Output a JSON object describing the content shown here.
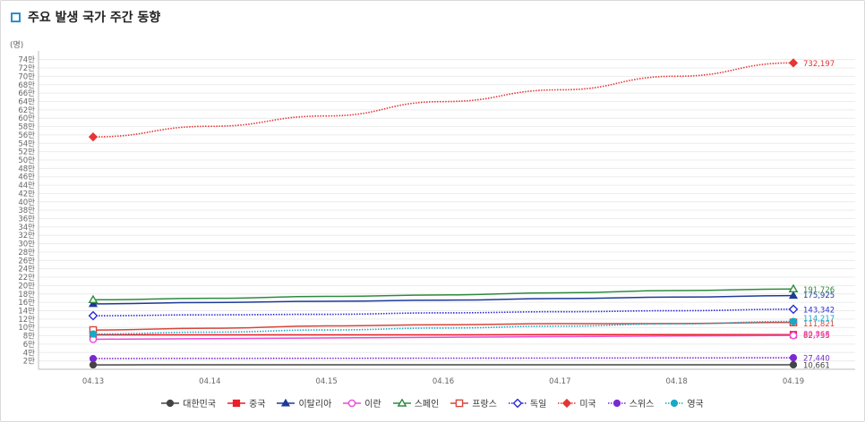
{
  "header": {
    "title": "주요 발생 국가 주간 동향",
    "unit_label": "(명)"
  },
  "chart_data": {
    "type": "line",
    "title": "주요 발생 국가 주간 동향",
    "xlabel": "",
    "ylabel": "(명)",
    "categories": [
      "04.13",
      "04.14",
      "04.15",
      "04.16",
      "04.17",
      "04.18",
      "04.19"
    ],
    "ylim": [
      0,
      750000
    ],
    "y_ticks": [
      "2만",
      "4만",
      "6만",
      "8만",
      "10만",
      "12만",
      "14만",
      "16만",
      "18만",
      "20만",
      "22만",
      "24만",
      "26만",
      "28만",
      "30만",
      "32만",
      "34만",
      "36만",
      "38만",
      "40만",
      "42만",
      "44만",
      "46만",
      "48만",
      "50만",
      "52만",
      "54만",
      "56만",
      "58만",
      "60만",
      "62만",
      "64만",
      "66만",
      "68만",
      "70만",
      "72만",
      "74만"
    ],
    "grid": true,
    "legend_position": "bottom",
    "series": [
      {
        "name": "대한민국",
        "color": "#444444",
        "marker": "circle-filled",
        "dash": "solid",
        "values": [
          10537,
          10564,
          10591,
          10613,
          10635,
          10653,
          10661
        ],
        "end_label": "10,661"
      },
      {
        "name": "중국",
        "color": "#e8202a",
        "marker": "square-filled",
        "dash": "solid",
        "values": [
          82160,
          82249,
          82295,
          82341,
          82692,
          82719,
          82735
        ],
        "end_label": "82,735"
      },
      {
        "name": "이탈리아",
        "color": "#1e3a9a",
        "marker": "triangle-filled",
        "dash": "solid",
        "values": [
          156363,
          159516,
          162488,
          165155,
          168941,
          172434,
          175925
        ],
        "end_label": "175,925"
      },
      {
        "name": "이란",
        "color": "#e84ad6",
        "marker": "circle-open",
        "dash": "solid",
        "values": [
          71686,
          73303,
          74877,
          76389,
          77995,
          79494,
          80868
        ],
        "end_label": "80,868"
      },
      {
        "name": "스페인",
        "color": "#2e8a3e",
        "marker": "triangle-open",
        "dash": "solid",
        "values": [
          166019,
          169496,
          174060,
          177633,
          182816,
          188068,
          191726
        ],
        "end_label": "191,726"
      },
      {
        "name": "프랑스",
        "color": "#d9453a",
        "marker": "square-open",
        "dash": "solid",
        "values": [
          93790,
          98076,
          103573,
          106206,
          108847,
          109252,
          111821
        ],
        "end_label": "111,821"
      },
      {
        "name": "독일",
        "color": "#2a2ad8",
        "marker": "diamond-open",
        "dash": "dotted",
        "values": [
          127854,
          130072,
          131359,
          134753,
          137439,
          139897,
          143342
        ],
        "end_label": "143,342"
      },
      {
        "name": "미국",
        "color": "#e53535",
        "marker": "diamond-filled",
        "dash": "dotted",
        "values": [
          555313,
          580619,
          605390,
          639664,
          667801,
          700282,
          732197
        ],
        "end_label": "732,197"
      },
      {
        "name": "스위스",
        "color": "#7a2ad0",
        "marker": "circle-filled",
        "dash": "dotted",
        "values": [
          25449,
          25802,
          26154,
          26445,
          26732,
          27068,
          27440
        ],
        "end_label": "27,440"
      },
      {
        "name": "영국",
        "color": "#17a9c6",
        "marker": "circle-filled",
        "dash": "dotted",
        "values": [
          84279,
          88621,
          93873,
          98476,
          103093,
          108692,
          114217
        ],
        "end_label": "114,217"
      }
    ]
  }
}
